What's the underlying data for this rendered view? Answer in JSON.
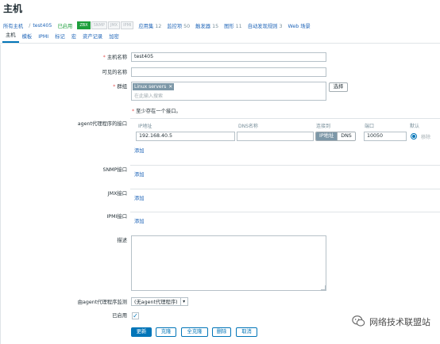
{
  "page": {
    "title": "主机"
  },
  "breadcrumb": {
    "all_hosts": "所有主机",
    "separator": "/",
    "host": "test405",
    "status": "已启用",
    "badges": [
      "ZBX",
      "SNMP",
      "JMX",
      "IPMI"
    ],
    "links": [
      {
        "label": "应用集",
        "count": "12"
      },
      {
        "label": "监控项",
        "count": "50"
      },
      {
        "label": "触发器",
        "count": "15"
      },
      {
        "label": "图形",
        "count": "11"
      },
      {
        "label": "自动发现规则",
        "count": "3"
      },
      {
        "label": "Web 场景",
        "count": ""
      }
    ]
  },
  "tabs": [
    "主机",
    "模板",
    "IPMI",
    "标记",
    "宏",
    "资产记录",
    "加密"
  ],
  "form": {
    "hostname_label": "主机名称",
    "hostname_value": "test405",
    "visible_name_label": "可见的名称",
    "visible_name_value": "",
    "groups_label": "群组",
    "group_tag": "Linux servers",
    "groups_placeholder": "在此输入搜索",
    "select_button": "选择",
    "interface_required": "至少存在一个接口。",
    "agent_label": "agent代理程序的接口",
    "col_ip": "IP地址",
    "col_dns": "DNS名称",
    "col_connect": "连接到",
    "col_port": "端口",
    "col_default": "默认",
    "agent_ip": "192.168.40.5",
    "agent_dns": "",
    "connect_ip": "IP地址",
    "connect_dns": "DNS",
    "agent_port": "10050",
    "remove": "移除",
    "add": "添加",
    "snmp_label": "SNMP接口",
    "jmx_label": "JMX接口",
    "ipmi_label": "IPMI接口",
    "desc_label": "描述",
    "proxy_label": "由agent代理程序监测",
    "proxy_value": "(无agent代理程序)",
    "enabled_label": "已启用",
    "enabled_checked": true
  },
  "actions": {
    "update": "更新",
    "clone": "克隆",
    "full_clone": "全克隆",
    "delete": "删除",
    "cancel": "取消"
  },
  "watermark": "网络技术联盟站",
  "colors": {
    "accent": "#0275b8",
    "link": "#1f65b8",
    "enabled": "#1e9f3c",
    "tag": "#7d98a8"
  }
}
